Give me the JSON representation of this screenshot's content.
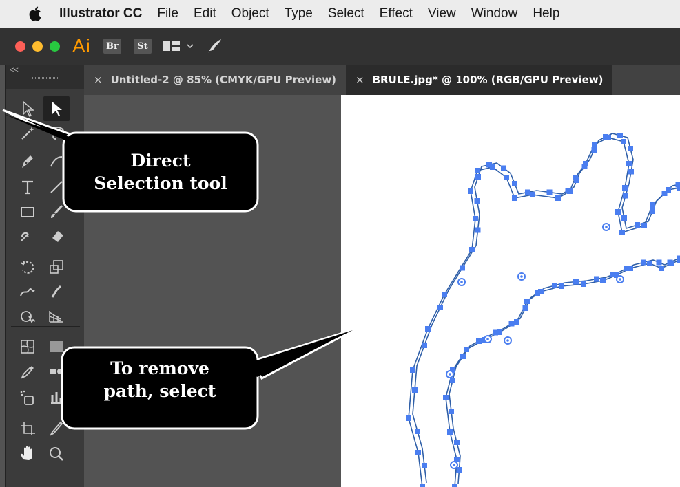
{
  "menubar": {
    "app_name": "Illustrator CC",
    "items": [
      "File",
      "Edit",
      "Object",
      "Type",
      "Select",
      "Effect",
      "View",
      "Window",
      "Help"
    ]
  },
  "appbar": {
    "app_logo": "Ai",
    "bridge_label": "Br",
    "stock_label": "St",
    "icons": [
      "workspace-switcher-icon",
      "chevron-down-icon",
      "feather-icon"
    ]
  },
  "toolpanel": {
    "collapse_label": "<<",
    "tools": [
      "selection-tool-icon",
      "direct-selection-tool-icon",
      "magic-wand-tool-icon",
      "lasso-tool-icon",
      "pen-tool-icon",
      "curvature-tool-icon",
      "type-tool-icon",
      "line-segment-tool-icon",
      "rectangle-tool-icon",
      "paintbrush-tool-icon",
      "shaper-tool-icon",
      "eraser-tool-icon",
      "rotate-tool-icon",
      "scale-tool-icon",
      "width-tool-icon",
      "puppet-warp-tool-icon",
      "shape-builder-tool-icon",
      "perspective-grid-tool-icon",
      "mesh-tool-icon",
      "gradient-tool-icon",
      "eyedropper-tool-icon",
      "blend-tool-icon",
      "symbol-sprayer-tool-icon",
      "column-graph-tool-icon",
      "artboard-tool-icon",
      "slice-tool-icon",
      "hand-tool-icon",
      "zoom-tool-icon"
    ]
  },
  "tabs": [
    {
      "close": "×",
      "label": "Untitled-2 @ 85% (CMYK/GPU Preview)"
    },
    {
      "close": "×",
      "label": "BRULE.jpg* @ 100% (RGB/GPU Preview)"
    }
  ],
  "callouts": {
    "direct_selection_line1": "Direct",
    "direct_selection_line2": "Selection tool",
    "remove_line1": "To remove",
    "remove_line2": "path, select"
  },
  "colors": {
    "path_blue": "#4a7ef0",
    "path_stroke": "#2f5fa8",
    "traffic_red": "#fd5f57",
    "traffic_yellow": "#febc2e",
    "traffic_green": "#28c840",
    "ai_orange": "#ff9a00"
  }
}
